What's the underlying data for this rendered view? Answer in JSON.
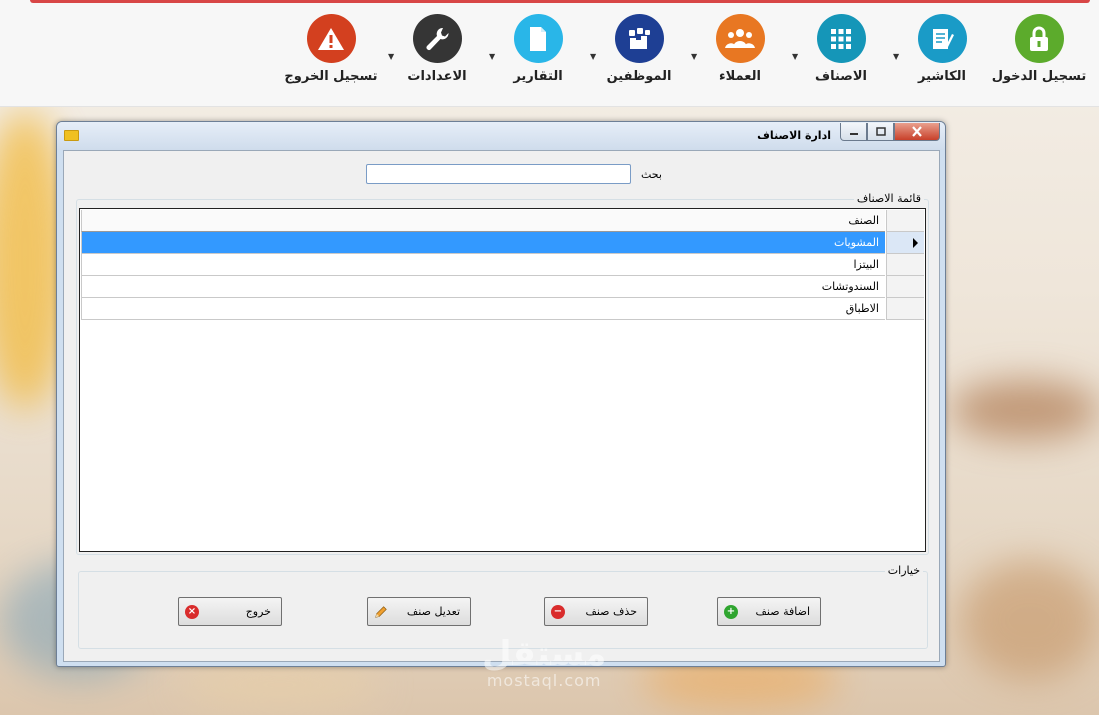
{
  "colors": {
    "login": "#5cab2c",
    "cashier": "#1a9bc7",
    "categories": "#1596b8",
    "customers": "#e87722",
    "employees": "#1e3f94",
    "reports": "#29b6e8",
    "settings": "#353535",
    "logout": "#d3401f",
    "selection": "#3399ff"
  },
  "nav": {
    "items": [
      {
        "label": "تسجيل الدخول",
        "icon": "lock-icon"
      },
      {
        "label": "الكاشير",
        "icon": "cashier-document-icon"
      },
      {
        "label": "الاصناف",
        "icon": "grid-icon"
      },
      {
        "label": "العملاء",
        "icon": "customers-group-icon"
      },
      {
        "label": "الموظفين",
        "icon": "employees-icon"
      },
      {
        "label": "التقارير",
        "icon": "report-file-icon"
      },
      {
        "label": "الاعدادات",
        "icon": "wrench-icon"
      },
      {
        "label": "تسجيل الخروج",
        "icon": "warning-icon"
      }
    ]
  },
  "window": {
    "title": "ادارة الاصناف"
  },
  "search": {
    "label": "بحث",
    "value": ""
  },
  "categories_group": {
    "title": "قائمة الاصناف",
    "column_header": "الصنف",
    "rows": [
      "المشويات",
      "البيتزا",
      "السندوتشات",
      "الاطباق"
    ],
    "selected_index": 0
  },
  "options_group": {
    "title": "خيارات",
    "add_label": "اضافة صنف",
    "delete_label": "حذف صنف",
    "edit_label": "تعديل صنف",
    "exit_label": "خروج"
  },
  "watermark": {
    "arabic": "مستقل",
    "latin": "mostaql.com"
  }
}
